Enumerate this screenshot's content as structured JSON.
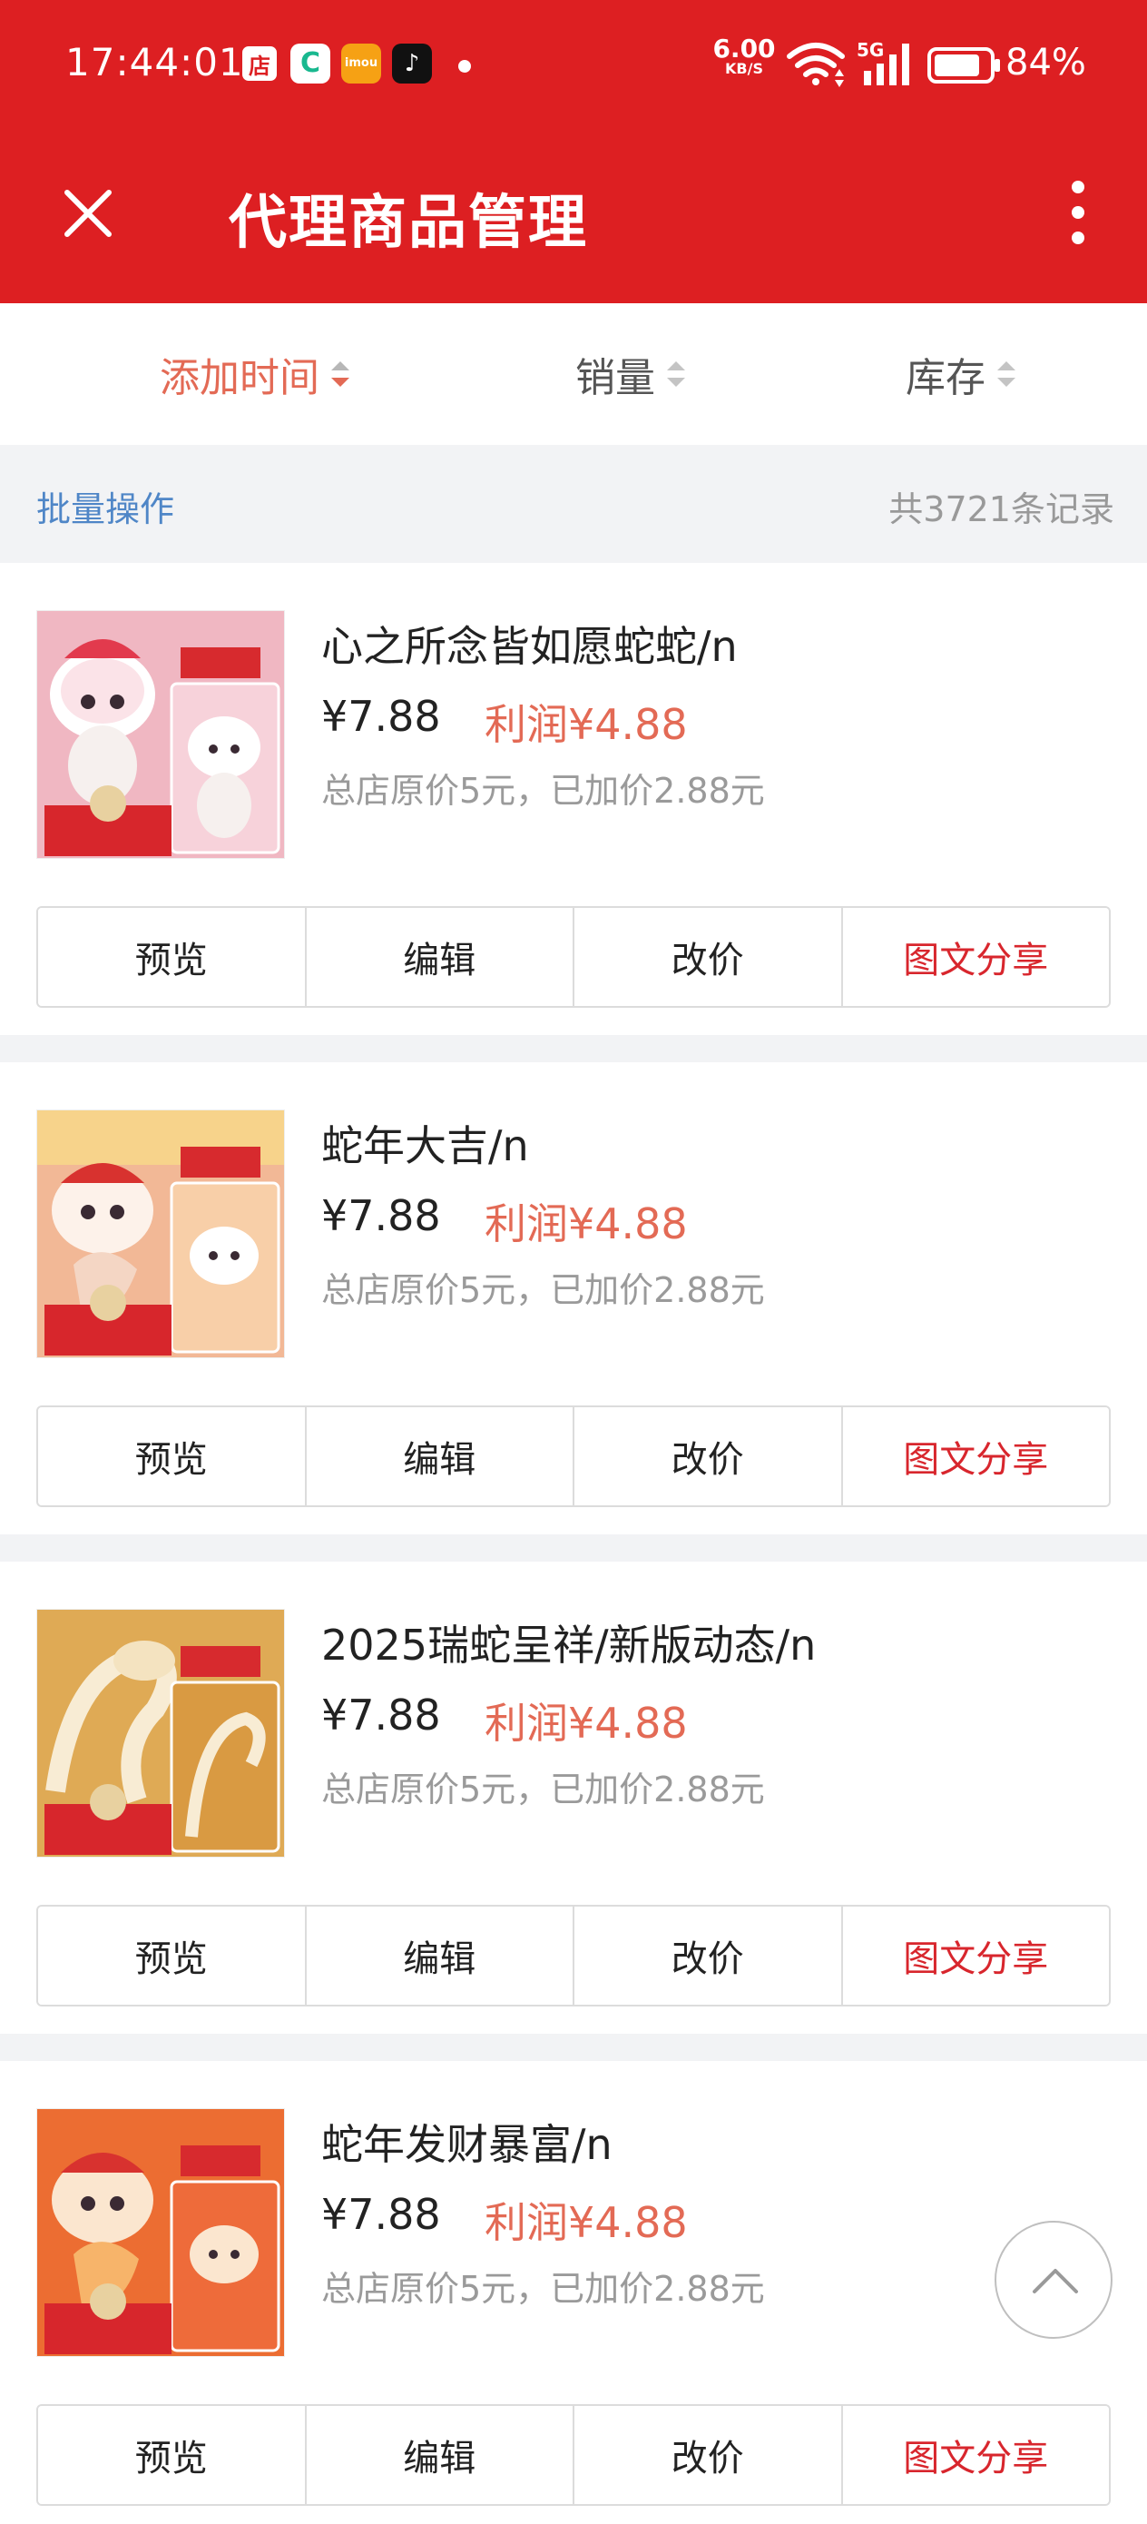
{
  "status_bar": {
    "time": "17:44:01",
    "app_icons": [
      "店",
      "C",
      "imou",
      "♪"
    ],
    "net_speed": "6.00",
    "net_speed_unit": "KB/S",
    "network": "5G",
    "battery": "84%"
  },
  "nav": {
    "title": "代理商品管理"
  },
  "sort": {
    "added_time": "添加时间",
    "sales": "销量",
    "stock": "库存"
  },
  "batch": {
    "label": "批量操作",
    "total": "共3721条记录"
  },
  "product_labels": {
    "preview": "预览",
    "edit": "编辑",
    "change_price": "改价",
    "share": "图文分享"
  },
  "products": [
    {
      "name": "心之所念皆如愿蛇蛇/n",
      "price": "¥7.88",
      "profit": "利润¥4.88",
      "note": "总店原价5元，已加价2.88元"
    },
    {
      "name": "蛇年大吉/n",
      "price": "¥7.88",
      "profit": "利润¥4.88",
      "note": "总店原价5元，已加价2.88元"
    },
    {
      "name": "2025瑞蛇呈祥/新版动态/n",
      "price": "¥7.88",
      "profit": "利润¥4.88",
      "note": "总店原价5元，已加价2.88元"
    },
    {
      "name": "蛇年发财暴富/n",
      "price": "¥7.88",
      "profit": "利润¥4.88",
      "note": "总店原价5元，已加价2.88元"
    }
  ],
  "colors": {
    "header": "#dd1f22",
    "accent": "#e36a55",
    "share_text": "#d8262d",
    "link": "#4f86c7"
  }
}
